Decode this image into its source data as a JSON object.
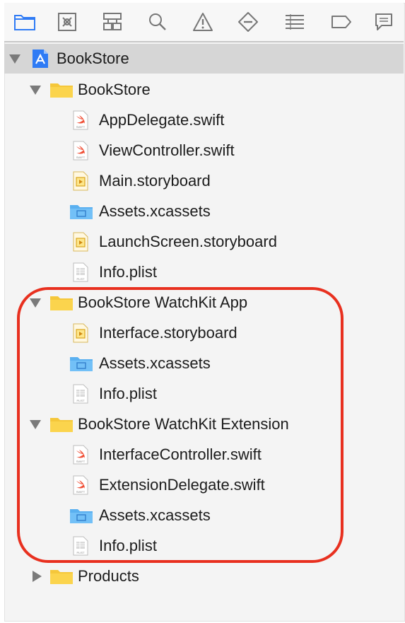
{
  "toolbar": {
    "icons": [
      "folder-icon",
      "xmark-box-icon",
      "hierarchy-icon",
      "search-icon",
      "warning-icon",
      "diamond-minus-icon",
      "list-icon",
      "tag-icon",
      "comment-icon"
    ],
    "accent": "#2f7bf5"
  },
  "navigator": {
    "project": "BookStore",
    "groups": [
      {
        "name": "BookStore",
        "expanded": true,
        "files": [
          {
            "name": "AppDelegate.swift",
            "kind": "swift"
          },
          {
            "name": "ViewController.swift",
            "kind": "swift"
          },
          {
            "name": "Main.storyboard",
            "kind": "storyboard"
          },
          {
            "name": "Assets.xcassets",
            "kind": "xcassets"
          },
          {
            "name": "LaunchScreen.storyboard",
            "kind": "storyboard"
          },
          {
            "name": "Info.plist",
            "kind": "plist"
          }
        ]
      },
      {
        "name": "BookStore WatchKit App",
        "expanded": true,
        "files": [
          {
            "name": "Interface.storyboard",
            "kind": "storyboard"
          },
          {
            "name": "Assets.xcassets",
            "kind": "xcassets"
          },
          {
            "name": "Info.plist",
            "kind": "plist"
          }
        ]
      },
      {
        "name": "BookStore WatchKit Extension",
        "expanded": true,
        "files": [
          {
            "name": "InterfaceController.swift",
            "kind": "swift"
          },
          {
            "name": "ExtensionDelegate.swift",
            "kind": "swift"
          },
          {
            "name": "Assets.xcassets",
            "kind": "xcassets"
          },
          {
            "name": "Info.plist",
            "kind": "plist"
          }
        ]
      },
      {
        "name": "Products",
        "expanded": false,
        "files": []
      }
    ]
  },
  "colors": {
    "highlight": "#e8301f",
    "folder": "#f5c73a",
    "swift": "#f05138",
    "xcassets": "#5ab0f0"
  },
  "icon_text": {
    "swift_tag": "SWIFT",
    "plist_tag": "PLIST"
  }
}
